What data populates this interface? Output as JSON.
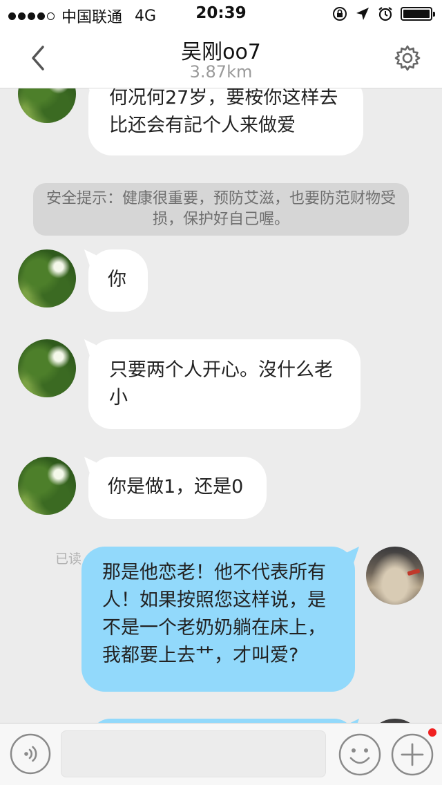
{
  "status_bar": {
    "carrier": "中国联通",
    "network": "4G",
    "time": "20:39"
  },
  "nav": {
    "title": "吴刚oo7",
    "subtitle": "3.87km"
  },
  "messages": [
    {
      "text": "何况何27岁，要桉你这样去比还会有記个人来做爱"
    },
    {
      "text": "你"
    },
    {
      "text": "只要两个人开心。沒什么老小"
    },
    {
      "text": "你是做1，还是0"
    },
    {
      "text": "那是他恋老！他不代表所有人！如果按照您这样说，是不是一个老奶奶躺在床上，我都要上去艹，才叫爱?"
    }
  ],
  "notice": "安全提示：健康很重要，预防艾滋，也要防范财物受损，保护好自己喔。",
  "read_status": "已读",
  "colors": {
    "my_bubble": "#92d9fb",
    "their_bubble": "#ffffff",
    "background": "#ececec",
    "notification_dot": "#f02020"
  },
  "icons": {
    "back": "chevron-left-icon",
    "settings": "gear-icon",
    "voice": "voice-icon",
    "emoji": "smiley-icon",
    "more": "plus-icon"
  }
}
